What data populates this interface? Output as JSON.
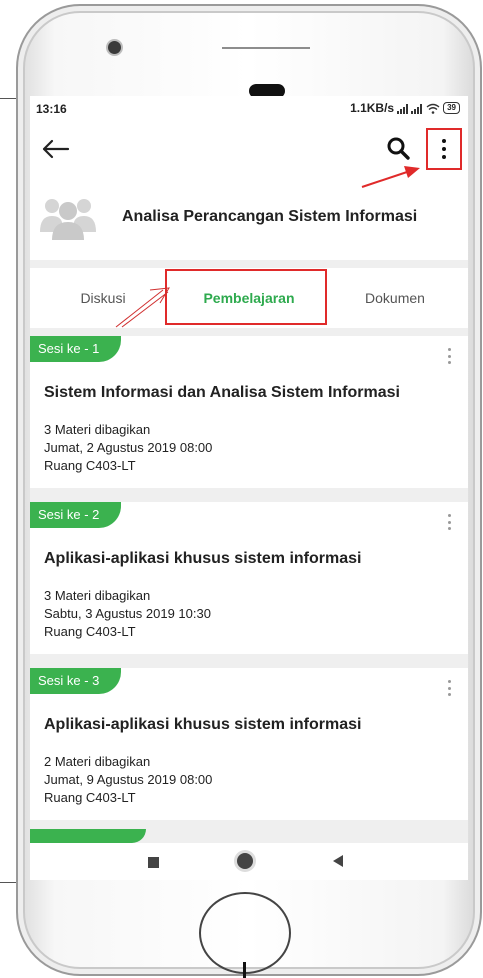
{
  "status_bar": {
    "time": "13:16",
    "network_speed": "1.1KB/s",
    "battery": "39"
  },
  "toolbar": {
    "back_icon": "arrow-left-icon",
    "search_icon": "search-icon",
    "more_icon": "more-vertical-icon"
  },
  "group": {
    "avatar_icon": "group-people-icon",
    "title": "Analisa Perancangan Sistem Informasi"
  },
  "tabs": [
    {
      "label": "Diskusi",
      "active": false
    },
    {
      "label": "Pembelajaran",
      "active": true
    },
    {
      "label": "Dokumen",
      "active": false
    }
  ],
  "sessions": [
    {
      "badge": "Sesi ke - 1",
      "title": "Sistem Informasi dan Analisa Sistem Informasi",
      "materials": "3  Materi dibagikan",
      "datetime": "Jumat, 2 Agustus 2019 08:00",
      "room": "Ruang C403-LT"
    },
    {
      "badge": "Sesi ke - 2",
      "title": "Aplikasi-aplikasi khusus sistem informasi",
      "materials": "3  Materi dibagikan",
      "datetime": "Sabtu, 3 Agustus 2019 10:30",
      "room": "Ruang C403-LT"
    },
    {
      "badge": "Sesi ke - 3",
      "title": "Aplikasi-aplikasi khusus sistem informasi",
      "materials": "2  Materi dibagikan",
      "datetime": "Jumat, 9 Agustus 2019 08:00",
      "room": "Ruang C403-LT"
    }
  ],
  "colors": {
    "accent_green": "#3bb24f",
    "annotation_red": "#e02a2a"
  }
}
